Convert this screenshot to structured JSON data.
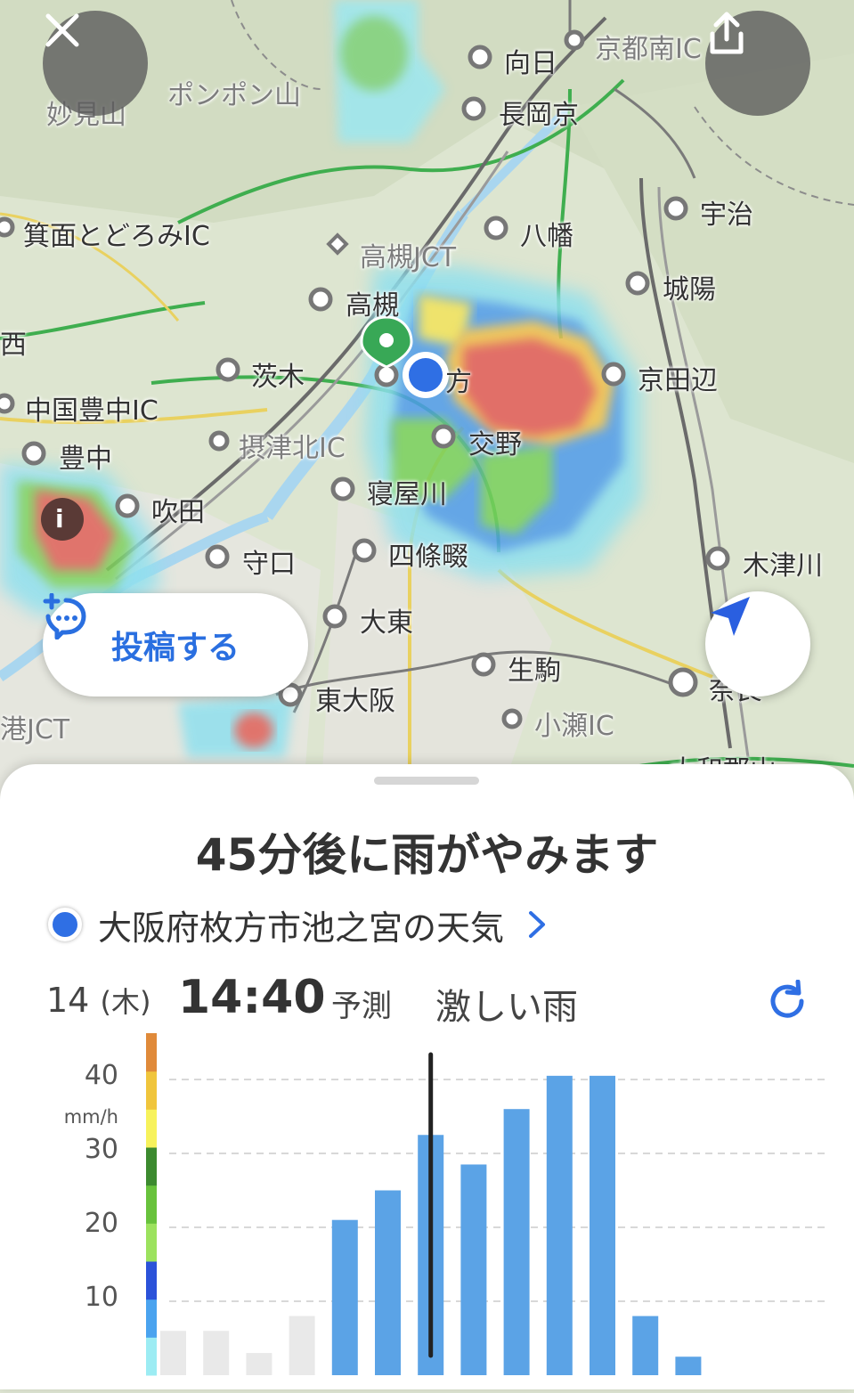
{
  "map": {
    "labels": [
      {
        "id": "mukou",
        "text": "向日"
      },
      {
        "id": "kyoto-minami-ic",
        "text": "京都南IC"
      },
      {
        "id": "nagaokakyo",
        "text": "長岡京"
      },
      {
        "id": "myokenzan",
        "text": "妙見山"
      },
      {
        "id": "ponpon",
        "text": "ポンポン山"
      },
      {
        "id": "uji",
        "text": "宇治"
      },
      {
        "id": "mino",
        "text": "箕面とどろみIC"
      },
      {
        "id": "yawata",
        "text": "八幡"
      },
      {
        "id": "takatsuki-jct",
        "text": "高槻JCT"
      },
      {
        "id": "joyo",
        "text": "城陽"
      },
      {
        "id": "takatsuki",
        "text": "高槻"
      },
      {
        "id": "nishi",
        "text": "西"
      },
      {
        "id": "ibaraki",
        "text": "茨木"
      },
      {
        "id": "hirakata",
        "text": "方"
      },
      {
        "id": "kyotanabe",
        "text": "京田辺"
      },
      {
        "id": "chugoku-toyonaka",
        "text": "中国豊中IC"
      },
      {
        "id": "settsu",
        "text": "摂津北IC"
      },
      {
        "id": "katano",
        "text": "交野"
      },
      {
        "id": "toyonaka",
        "text": "豊中"
      },
      {
        "id": "neyagawa",
        "text": "寝屋川"
      },
      {
        "id": "suita",
        "text": "吹田"
      },
      {
        "id": "moriguchi",
        "text": "守口"
      },
      {
        "id": "shijonawate",
        "text": "四條畷"
      },
      {
        "id": "kizugawa",
        "text": "木津川"
      },
      {
        "id": "daito",
        "text": "大東"
      },
      {
        "id": "ikoma",
        "text": "生駒"
      },
      {
        "id": "higashiosaka",
        "text": "東大阪"
      },
      {
        "id": "ko-jct",
        "text": "港JCT"
      },
      {
        "id": "kose",
        "text": "小瀬IC"
      },
      {
        "id": "yamato",
        "text": "大和郡山"
      },
      {
        "id": "nara",
        "text": "奈良"
      }
    ]
  },
  "buttons": {
    "close_icon": "close-icon",
    "share_icon": "share-icon",
    "post_label": "投稿する",
    "post_icon": "comment-plus-icon",
    "locate_icon": "navigation-arrow-icon"
  },
  "sheet": {
    "headline": "45分後に雨がやみます",
    "location": "大阪府枚方市池之宮の天気",
    "date_day": "14",
    "date_weekday": "(木)",
    "time": "14:40",
    "forecast_label": "予測",
    "condition": "激しい雨",
    "refresh_icon": "refresh-icon"
  },
  "chart_data": {
    "type": "bar",
    "ylabel": "mm/h",
    "yticks": [
      10,
      20,
      30,
      40
    ],
    "ylim": [
      0,
      48
    ],
    "values": [
      6,
      6,
      3,
      8,
      21,
      25,
      32.5,
      28.5,
      36,
      40.5,
      40.5,
      8,
      2.5
    ],
    "past_count": 4,
    "current_index": 6,
    "colors": {
      "past": "#e9e9e9",
      "future": "#5ba3e6",
      "indicator": "#222222",
      "scale": [
        "#9cecf3",
        "#4aa3ef",
        "#2b52d9",
        "#9ce25e",
        "#68c23c",
        "#3c8a2f",
        "#f7f25c",
        "#f0c53c",
        "#e08a3a"
      ]
    }
  },
  "colors": {
    "accent": "#2f6fe4",
    "text": "#333333"
  }
}
